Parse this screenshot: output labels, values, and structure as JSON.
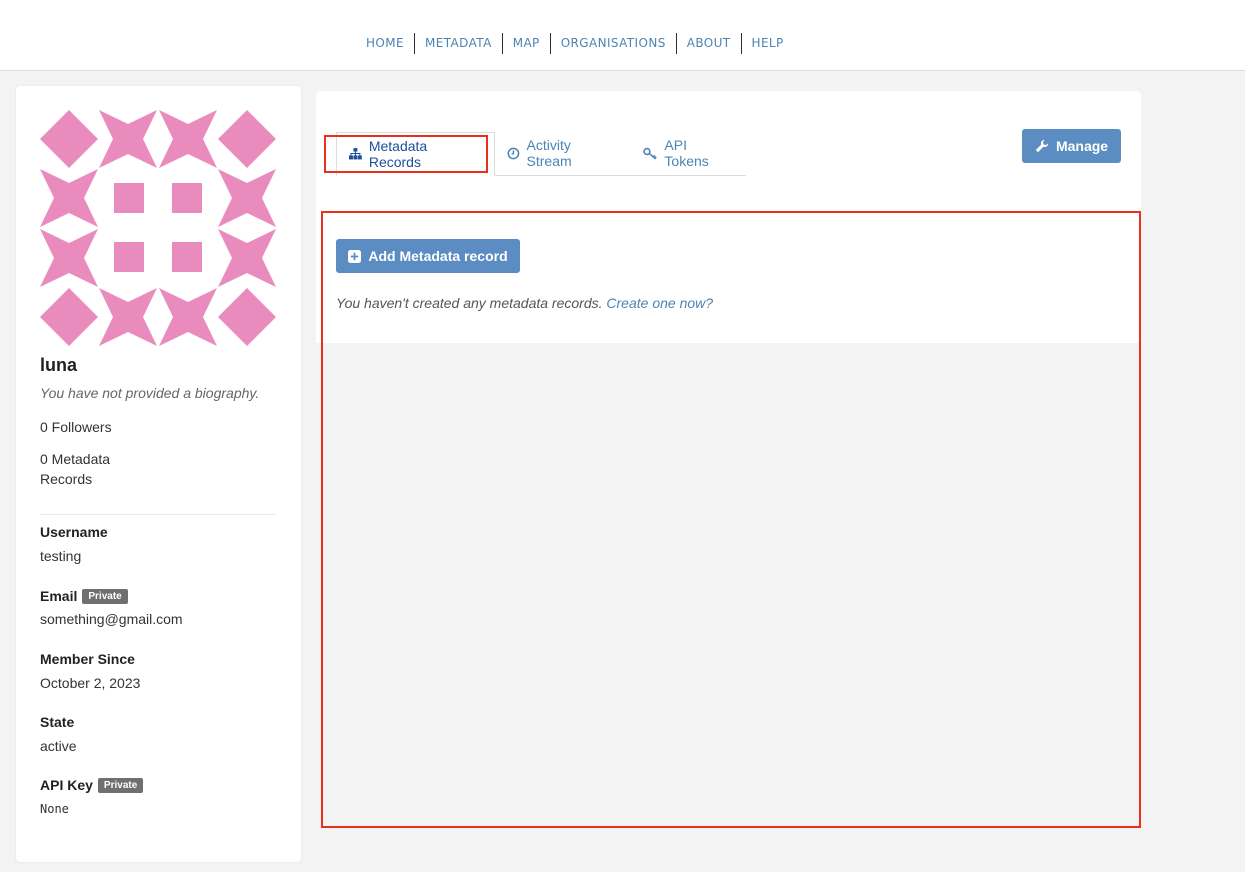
{
  "nav": {
    "items": [
      "HOME",
      "METADATA",
      "MAP",
      "ORGANISATIONS",
      "ABOUT",
      "HELP"
    ]
  },
  "profile": {
    "name": "luna",
    "bio": "You have not provided a biography.",
    "followers": "0 Followers",
    "records_count": "0 Metadata Records",
    "fields": {
      "username_label": "Username",
      "username_value": "testing",
      "email_label": "Email",
      "email_badge": "Private",
      "email_value": "something@gmail.com",
      "member_since_label": "Member Since",
      "member_since_value": "October 2, 2023",
      "state_label": "State",
      "state_value": "active",
      "api_key_label": "API Key",
      "api_key_badge": "Private",
      "api_key_value": "None"
    },
    "avatar_color": "#ea8bbd"
  },
  "tabs": [
    {
      "label": "Metadata Records",
      "icon": "sitemap-icon",
      "active": true
    },
    {
      "label": "Activity Stream",
      "icon": "clock-icon",
      "active": false
    },
    {
      "label": "API Tokens",
      "icon": "key-icon",
      "active": false
    }
  ],
  "actions": {
    "manage_label": "Manage",
    "add_record_label": "Add Metadata record"
  },
  "empty_state": {
    "message": "You haven't created any metadata records.",
    "link": "Create one now?"
  },
  "colors": {
    "accent": "#5b8dc2",
    "link": "#4d84b3",
    "annotation": "#e8301e"
  }
}
